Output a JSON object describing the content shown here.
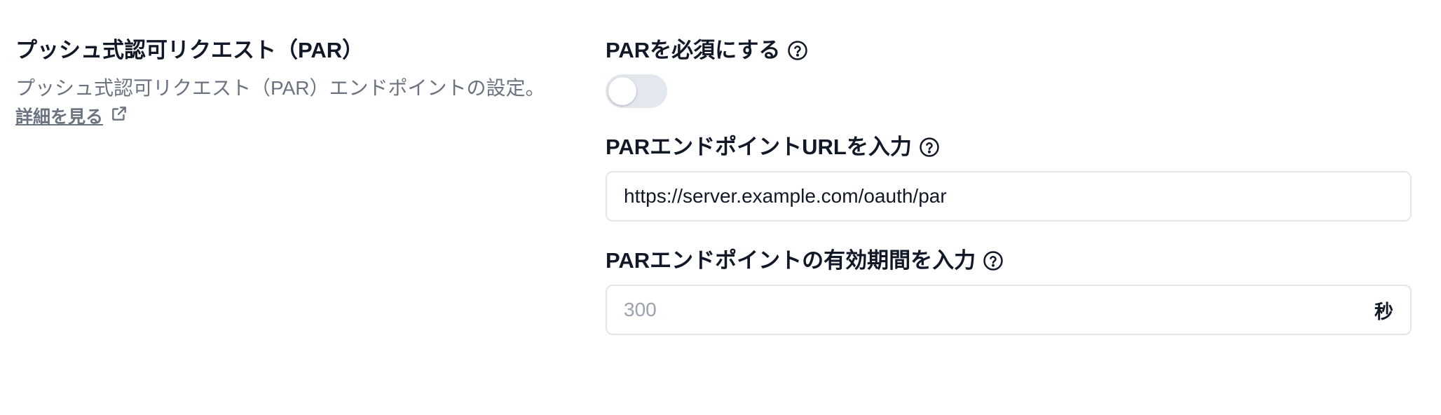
{
  "section": {
    "title": "プッシュ式認可リクエスト（PAR）",
    "description": "プッシュ式認可リクエスト（PAR）エンドポイントの設定。",
    "learn_more": "詳細を見る"
  },
  "fields": {
    "require_par": {
      "label": "PARを必須にする",
      "enabled": false
    },
    "par_endpoint_url": {
      "label": "PARエンドポイントURLを入力",
      "value": "https://server.example.com/oauth/par"
    },
    "par_expiry": {
      "label": "PARエンドポイントの有効期間を入力",
      "placeholder": "300",
      "suffix": "秒"
    }
  },
  "icons": {
    "help": "question-circle-icon",
    "external_link": "external-link-icon"
  },
  "colors": {
    "toggle_off": "#e3e7ee",
    "muted_text": "#6b7280"
  }
}
